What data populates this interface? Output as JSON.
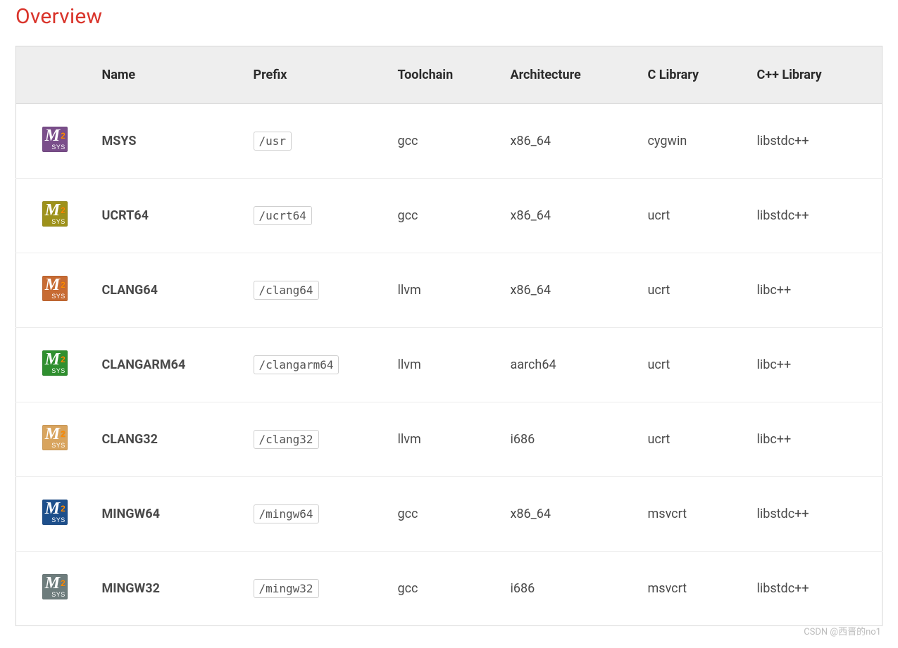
{
  "title": "Overview",
  "columns": {
    "icon": "",
    "name": "Name",
    "prefix": "Prefix",
    "toolchain": "Toolchain",
    "architecture": "Architecture",
    "c_library": "C Library",
    "cpp_library": "C++ Library"
  },
  "rows": [
    {
      "icon_color": "#7a4e8a",
      "name": "MSYS",
      "prefix": "/usr",
      "toolchain": "gcc",
      "architecture": "x86_64",
      "c_library": "cygwin",
      "cpp_library": "libstdc++"
    },
    {
      "icon_color": "#9d911a",
      "name": "UCRT64",
      "prefix": "/ucrt64",
      "toolchain": "gcc",
      "architecture": "x86_64",
      "c_library": "ucrt",
      "cpp_library": "libstdc++"
    },
    {
      "icon_color": "#c76b33",
      "name": "CLANG64",
      "prefix": "/clang64",
      "toolchain": "llvm",
      "architecture": "x86_64",
      "c_library": "ucrt",
      "cpp_library": "libc++"
    },
    {
      "icon_color": "#2f8f2f",
      "name": "CLANGARM64",
      "prefix": "/clangarm64",
      "toolchain": "llvm",
      "architecture": "aarch64",
      "c_library": "ucrt",
      "cpp_library": "libc++"
    },
    {
      "icon_color": "#d8a45e",
      "name": "CLANG32",
      "prefix": "/clang32",
      "toolchain": "llvm",
      "architecture": "i686",
      "c_library": "ucrt",
      "cpp_library": "libc++"
    },
    {
      "icon_color": "#1d4f8b",
      "name": "MINGW64",
      "prefix": "/mingw64",
      "toolchain": "gcc",
      "architecture": "x86_64",
      "c_library": "msvcrt",
      "cpp_library": "libstdc++"
    },
    {
      "icon_color": "#6d7c7c",
      "name": "MINGW32",
      "prefix": "/mingw32",
      "toolchain": "gcc",
      "architecture": "i686",
      "c_library": "msvcrt",
      "cpp_library": "libstdc++"
    }
  ],
  "attribution": "CSDN @西晋的no1"
}
